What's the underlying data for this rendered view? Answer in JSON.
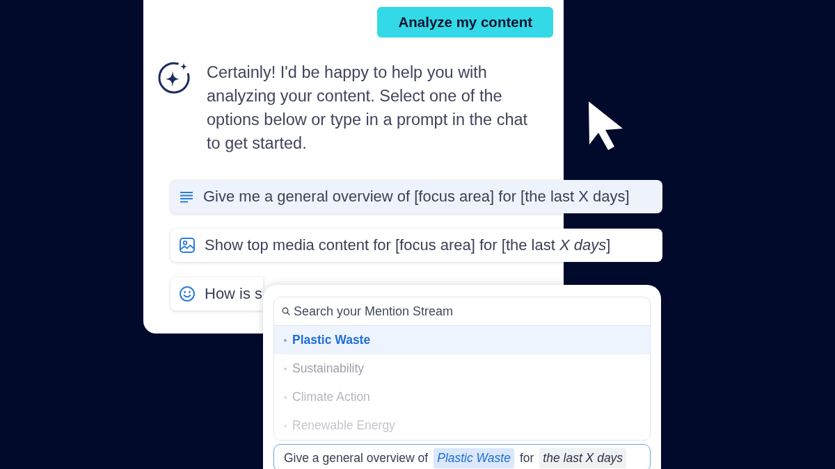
{
  "chat": {
    "user_message": {
      "text": "Analyze my content"
    },
    "assistant_message": {
      "text": "Certainly! I'd be happy to help you with analyzing your content. Select one of the options below or type in a prompt in the chat to get started."
    },
    "suggestions": [
      {
        "kind": "overview",
        "label": "Give me a general overview of [focus area] for [the last X days]",
        "selected": true
      },
      {
        "kind": "media",
        "label": "Show top media content for [focus area] for [the last *X days*]",
        "selected": false
      },
      {
        "kind": "sentiment",
        "label": "How is s",
        "selected": false
      }
    ]
  },
  "topic_picker": {
    "search": {
      "placeholder": "Search your Mention Stream"
    },
    "topics": [
      {
        "label": "Plastic Waste",
        "selected": true
      },
      {
        "label": "Sustainability",
        "selected": false
      },
      {
        "label": "Climate Action",
        "selected": false
      },
      {
        "label": "Renewable Energy",
        "selected": false
      }
    ],
    "prompt": {
      "parts": [
        {
          "kind": "text",
          "text": "Give a general overview of"
        },
        {
          "kind": "topic",
          "text": "Plastic Waste"
        },
        {
          "kind": "text",
          "text": "for"
        },
        {
          "kind": "timeframe",
          "text": "the last X days"
        }
      ]
    }
  }
}
